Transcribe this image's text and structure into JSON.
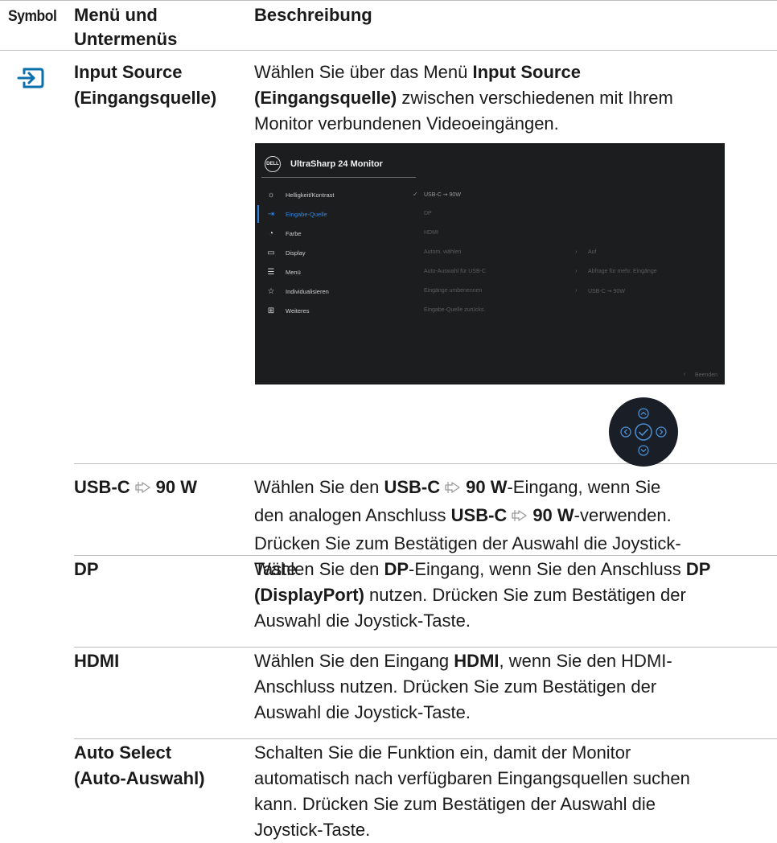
{
  "header": {
    "symbol": "Symbol",
    "menu_line1": "Menü und",
    "menu_line2": "Untermenüs",
    "desc": "Beschreibung"
  },
  "input_source": {
    "icon": "input-source-icon",
    "menu_line1": "Input Source",
    "menu_line2": "(Eingangsquelle)",
    "desc_l1_pre": "Wählen Sie über das Menü ",
    "desc_l1_bold": "Input Source",
    "desc_l2_bold": "(Eingangsquelle)",
    "desc_l2_post": " zwischen verschiedenen mit Ihrem",
    "desc_l3": "Monitor verbundenen Videoeingängen."
  },
  "osd": {
    "logo": "DELL",
    "title": "UltraSharp 24 Monitor",
    "menu": [
      {
        "icon": "brightness-icon",
        "glyph": "☼",
        "label": "Helligkeit/Kontrast"
      },
      {
        "icon": "input-icon",
        "glyph": "⇥",
        "label": "Eingabe-Quelle"
      },
      {
        "icon": "color-icon",
        "glyph": "◔",
        "label": "Farbe"
      },
      {
        "icon": "display-icon",
        "glyph": "▭",
        "label": "Display"
      },
      {
        "icon": "menu-icon",
        "glyph": "☰",
        "label": "Menü"
      },
      {
        "icon": "star-icon",
        "glyph": "☆",
        "label": "Individualisieren"
      },
      {
        "icon": "others-icon",
        "glyph": "⊞",
        "label": "Weiteres"
      }
    ],
    "sub": [
      "USB-C ⇝ 90W",
      "DP",
      "HDMI",
      "Autom. wählen",
      "Auto-Auswahl für USB-C",
      "Eingänge umbenennen",
      "Eingabe-Quelle zurücks."
    ],
    "sub_values": [
      "Auf",
      "Abfrage für mehr. Eingänge",
      "USB-C ⇝ 90W"
    ],
    "exit": "Beenden",
    "accent_color": "#2f86e8",
    "background": "#1c1d1f"
  },
  "rows": {
    "usbc": {
      "menu_pre": "USB-C",
      "menu_post": "90 W",
      "l1_pre": "Wählen Sie den ",
      "l1_bold1": "USB-C",
      "l1_bold2": "90 W",
      "l1_post": "-Eingang, wenn Sie",
      "l2_pre": "den analogen Anschluss ",
      "l2_bold1": "USB-C",
      "l2_bold2": "90 W",
      "l2_post": "-verwenden.",
      "l3": "Drücken Sie zum Bestätigen der Auswahl die Joystick-",
      "l4": "Taste."
    },
    "dp": {
      "menu": "DP",
      "l1_pre": "Wählen Sie den ",
      "l1_bold": "DP",
      "l1_mid": "-Eingang, wenn Sie den Anschluss ",
      "l1_bold2": "DP",
      "l2_bold": "(DisplayPort)",
      "l2_post": " nutzen. Drücken Sie zum Bestätigen der",
      "l3": "Auswahl die Joystick-Taste."
    },
    "hdmi": {
      "menu": "HDMI",
      "l1_pre": "Wählen Sie den Eingang ",
      "l1_bold": "HDMI",
      "l1_post": ", wenn Sie den HDMI-",
      "l2": "Anschluss nutzen. Drücken Sie zum Bestätigen der",
      "l3": "Auswahl die Joystick-Taste."
    },
    "auto": {
      "menu_line1": "Auto Select",
      "menu_line2": "(Auto-Auswahl)",
      "l1": "Schalten Sie die Funktion ein, damit der Monitor",
      "l2": "automatisch nach verfügbaren Eingangsquellen suchen",
      "l3": "kann. Drücken Sie zum Bestätigen der Auswahl die",
      "l4": "Joystick-Taste."
    }
  }
}
